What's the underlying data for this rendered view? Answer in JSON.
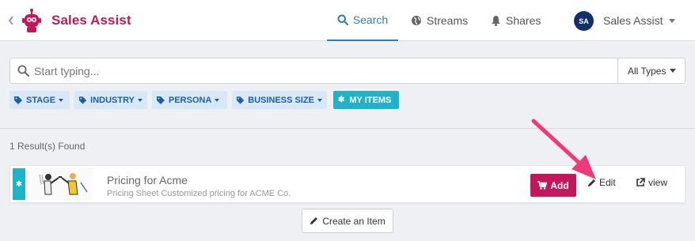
{
  "header": {
    "app_title": "Sales Assist",
    "back_icon": "chevron-left-icon",
    "logo_icon": "robot-logo-icon",
    "tabs": [
      {
        "label": "Search",
        "icon": "search-icon",
        "active": true
      },
      {
        "label": "Streams",
        "icon": "globe-icon",
        "active": false
      },
      {
        "label": "Shares",
        "icon": "bell-icon",
        "active": false
      }
    ],
    "user": {
      "initials": "SA",
      "name": "Sales Assist"
    }
  },
  "search": {
    "placeholder": "Start typing...",
    "value": "",
    "type_select": "All Types"
  },
  "filters": [
    {
      "label": "STAGE",
      "icon": "tag-icon"
    },
    {
      "label": "INDUSTRY",
      "icon": "tag-icon"
    },
    {
      "label": "PERSONA",
      "icon": "tag-icon"
    },
    {
      "label": "BUSINESS SIZE",
      "icon": "tag-icon"
    },
    {
      "label": "MY ITEMS",
      "icon": "asterisk-icon",
      "active": true
    }
  ],
  "results": {
    "count_text": "1 Result(s) Found",
    "items": [
      {
        "flag_icon": "asterisk-icon",
        "thumbnail_icon": "handshake-illustration",
        "title": "Pricing for Acme",
        "description": "Pricing Sheet Customized pricing for ACME Co.",
        "add_label": "Add",
        "edit_label": "Edit",
        "view_label": "view"
      }
    ]
  },
  "create_item_label": "Create an Item",
  "colors": {
    "brand": "#c2185b",
    "accent_blue": "#2f7cc1",
    "teal": "#1fb3c9",
    "callout_pink": "#f0387a"
  }
}
